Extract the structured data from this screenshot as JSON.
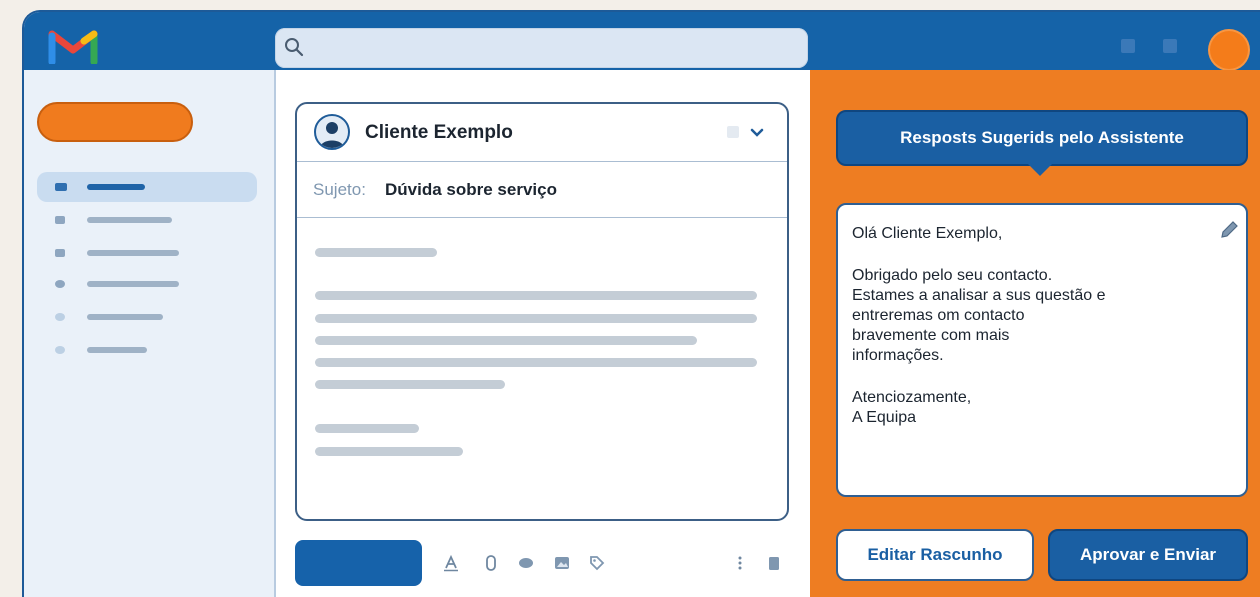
{
  "search": {
    "placeholder": "",
    "value": ""
  },
  "sidebar": {
    "items": [
      {
        "icon": "inbox-icon",
        "active": true
      },
      {
        "icon": "snooze-icon",
        "active": false
      },
      {
        "icon": "star-icon",
        "active": false
      },
      {
        "icon": "sent-icon",
        "active": false
      },
      {
        "icon": "draft-icon",
        "active": false
      },
      {
        "icon": "more-icon",
        "active": false
      }
    ]
  },
  "email": {
    "sender": "Cliente Exemplo",
    "subject_label": "Sujeto:",
    "subject": "Dúvida sobre serviço"
  },
  "assistant": {
    "title": "Resposts Sugerids pelo Assistente",
    "reply": {
      "greeting": "Olá Cliente Exemplo,",
      "line1": "Obrigado pelo seu contacto.",
      "line2": "Estames a analisar a sus questão e",
      "line3": "entreremas om contacto",
      "line4": "bravemente com mais",
      "line5": "informações.",
      "closing": "Atenciozamente,",
      "signature": "A Equipa"
    },
    "edit_label": "Editar Rascunho",
    "approve_label": "Aprovar e Enviar"
  },
  "colors": {
    "brand_blue": "#1563a8",
    "accent_orange": "#ee7d22"
  }
}
